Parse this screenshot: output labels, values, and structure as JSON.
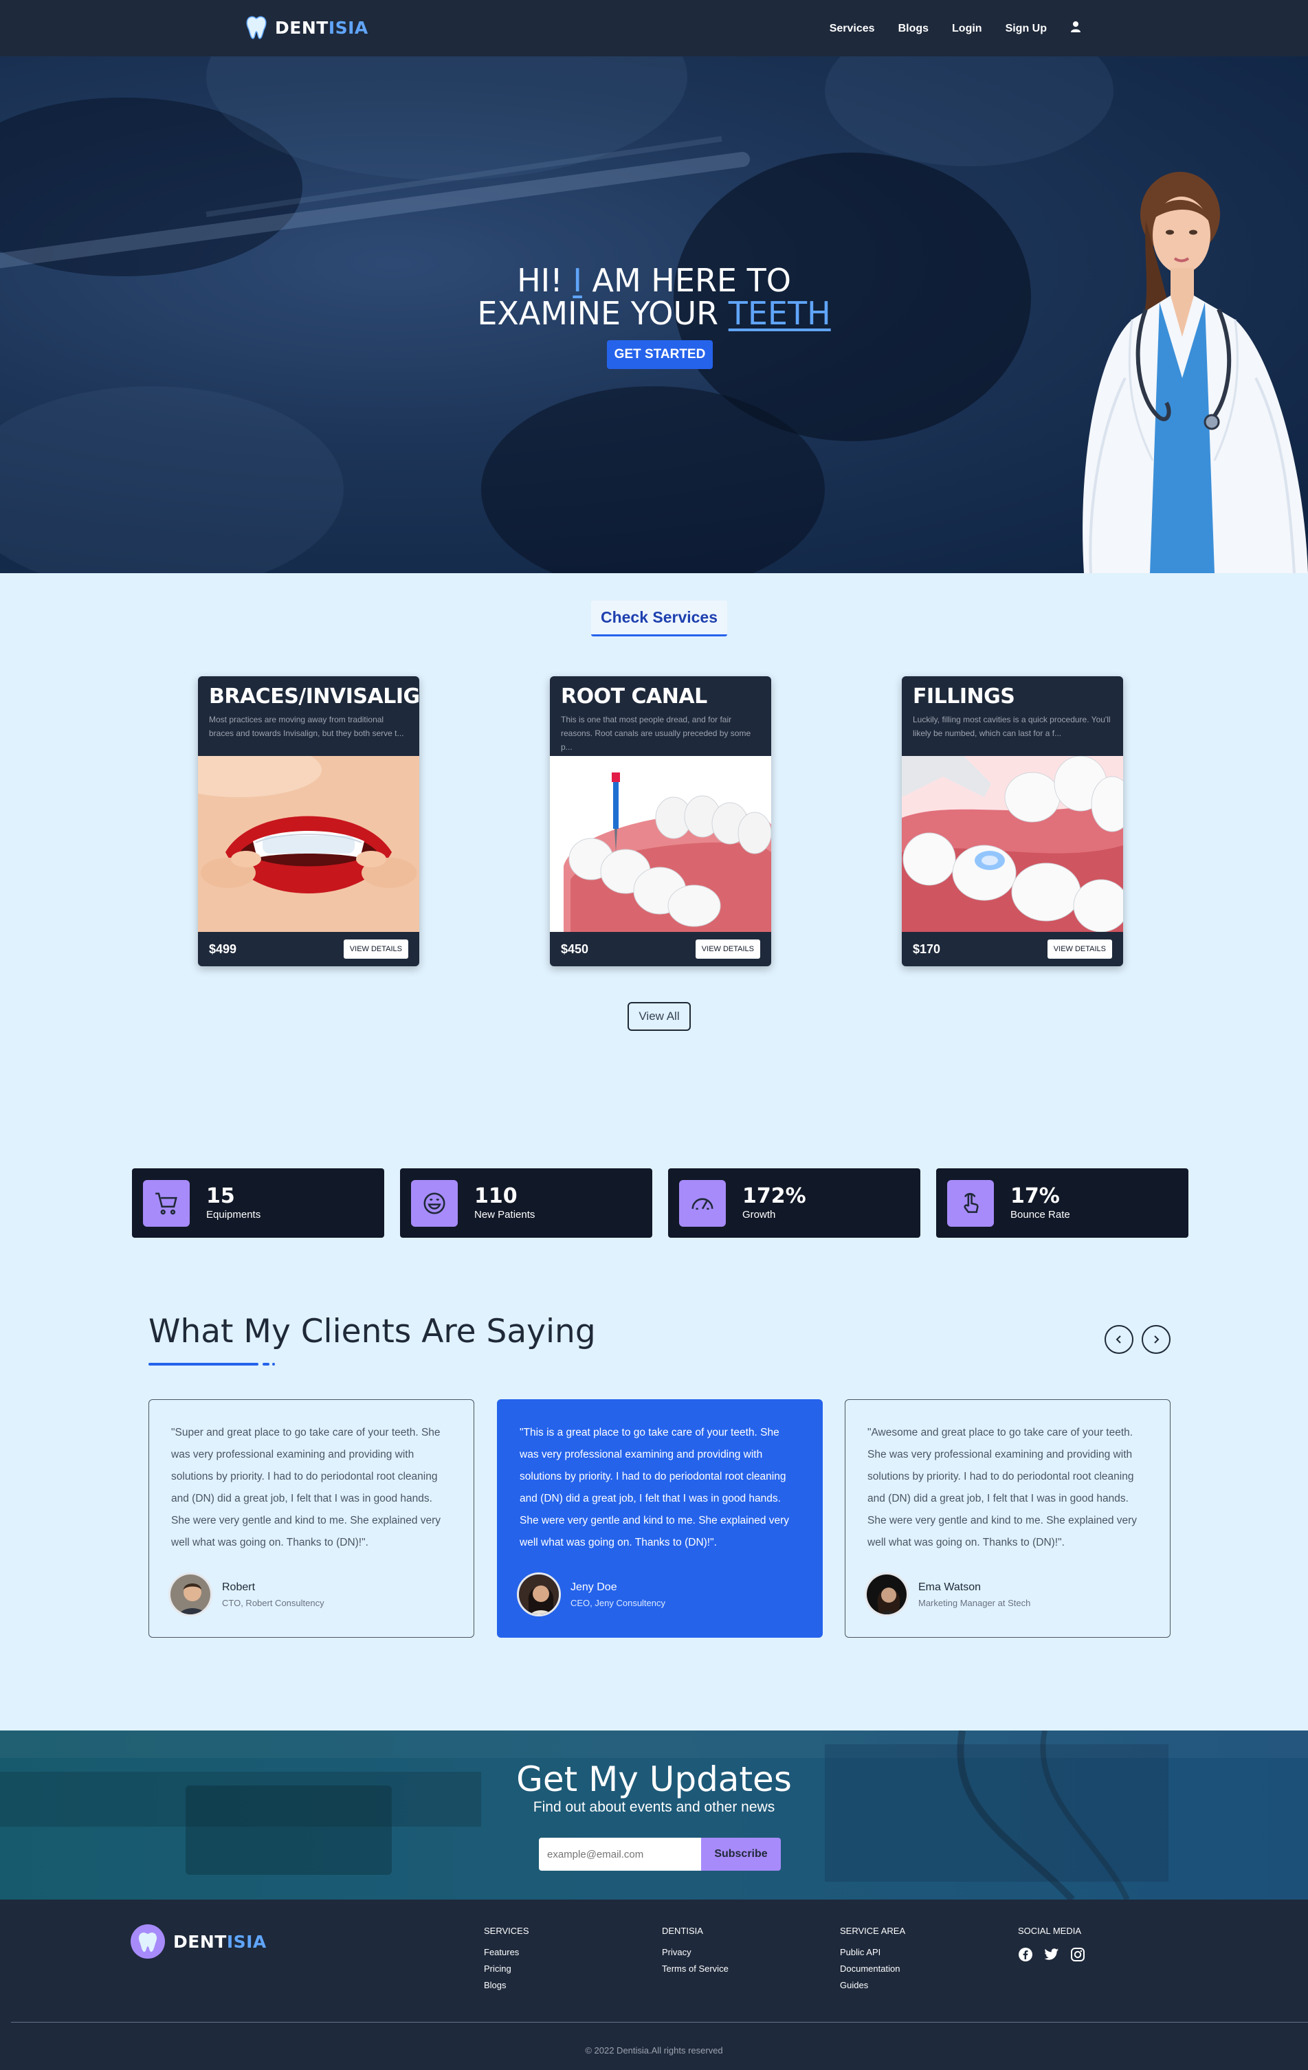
{
  "nav": {
    "brand_main": "DENT",
    "brand_accent": "ISIA",
    "links": [
      "Services",
      "Blogs",
      "Login",
      "Sign Up"
    ],
    "user_icon": "user-icon"
  },
  "hero": {
    "line1_a": "HI! ",
    "line1_hl": "I",
    "line1_b": " AM HERE TO",
    "line2_a": "EXAMINE YOUR ",
    "line2_hl": "TEETH",
    "cta": "GET STARTED"
  },
  "services": {
    "heading": "Check Services",
    "cards": [
      {
        "title": "BRACES/INVISALIGN",
        "desc": "Most practices are moving away from traditional braces and towards Invisalign, but they both serve t...",
        "price": "$499",
        "button": "VIEW DETAILS"
      },
      {
        "title": "ROOT CANAL",
        "desc": "This is one that most people dread, and for fair reasons. Root canals are usually preceded by some p...",
        "price": "$450",
        "button": "VIEW DETAILS"
      },
      {
        "title": "FILLINGS",
        "desc": "Luckily, filling most cavities is a quick procedure. You'll likely be numbed, which can last for a f...",
        "price": "$170",
        "button": "VIEW DETAILS"
      }
    ],
    "view_all": "View All"
  },
  "stats": [
    {
      "value": "15",
      "label": "Equipments",
      "icon": "cart-icon"
    },
    {
      "value": "110",
      "label": "New Patients",
      "icon": "smile-icon"
    },
    {
      "value": "172%",
      "label": "Growth",
      "icon": "gauge-icon"
    },
    {
      "value": "17%",
      "label": "Bounce Rate",
      "icon": "pointer-icon"
    }
  ],
  "testimonials": {
    "heading": "What My Clients Are Saying",
    "items": [
      {
        "quote": "\"Super and great place to go take care of your teeth. She was very professional examining and providing with solutions by priority. I had to do periodontal root cleaning and (DN) did a great job, I felt that I was in good hands. She were very gentle and kind to me. She explained very well what was going on. Thanks to (DN)!\".",
        "name": "Robert",
        "role": "CTO, Robert Consultency"
      },
      {
        "quote": "\"This is a great place to go take care of your teeth. She was very professional examining and providing with solutions by priority. I had to do periodontal root cleaning and (DN) did a great job, I felt that I was in good hands. She were very gentle and kind to me. She explained very well what was going on. Thanks to (DN)!\".",
        "name": "Jeny Doe",
        "role": "CEO, Jeny Consultency"
      },
      {
        "quote": "\"Awesome and great place to go take care of your teeth. She was very professional examining and providing with solutions by priority. I had to do periodontal root cleaning and (DN) did a great job, I felt that I was in good hands. She were very gentle and kind to me. She explained very well what was going on. Thanks to (DN)!\".",
        "name": "Ema Watson",
        "role": "Marketing Manager at Stech"
      }
    ]
  },
  "newsletter": {
    "title": "Get My Updates",
    "subtitle": "Find out about events and other news",
    "placeholder": "example@email.com",
    "button": "Subscribe"
  },
  "footer": {
    "brand_main": "DENT",
    "brand_accent": "ISIA",
    "columns": [
      {
        "heading": "SERVICES",
        "items": [
          "Features",
          "Pricing",
          "Blogs"
        ]
      },
      {
        "heading": "DENTISIA",
        "items": [
          "Privacy",
          "Terms of Service"
        ]
      },
      {
        "heading": "SERVICE AREA",
        "items": [
          "Public API",
          "Documentation",
          "Guides"
        ]
      },
      {
        "heading": "SOCIAL MEDIA",
        "items": []
      }
    ],
    "social_icons": [
      "facebook-icon",
      "twitter-icon",
      "instagram-icon"
    ],
    "copyright": "© 2022 Dentisia.All rights reserved"
  },
  "colors": {
    "accent": "#2563eb",
    "brand_accent": "#60a5fa",
    "stat_icon_bg": "#a78bfa",
    "dark": "#1e293b"
  }
}
